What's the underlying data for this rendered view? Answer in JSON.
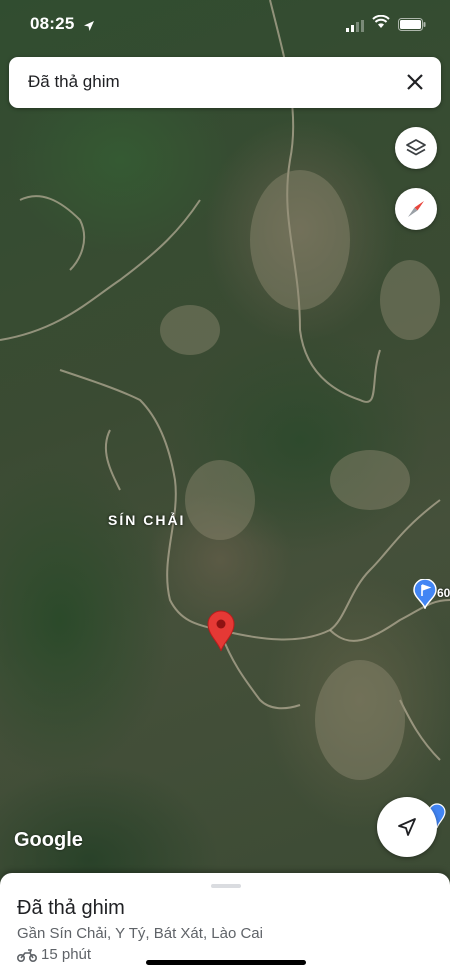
{
  "status": {
    "time": "08:25"
  },
  "search": {
    "query": "Đã thả ghim"
  },
  "map": {
    "place_label": "SÍN CHẢI",
    "flag_label": "60",
    "attribution": "Google"
  },
  "sheet": {
    "title": "Đã thả ghim",
    "address": "Gần Sín Chải, Y Tý, Bát Xát, Lào Cai",
    "travel_time": "15 phút"
  },
  "icons": {
    "close": "close-icon",
    "layers": "layers-icon",
    "compass": "compass-icon",
    "my_location": "navigation-arrow-icon",
    "pin": "map-pin-icon",
    "motorbike": "motorbike-icon"
  },
  "colors": {
    "pin": "#e53935",
    "flag": "#4285f4",
    "compass_red": "#e8453c"
  }
}
